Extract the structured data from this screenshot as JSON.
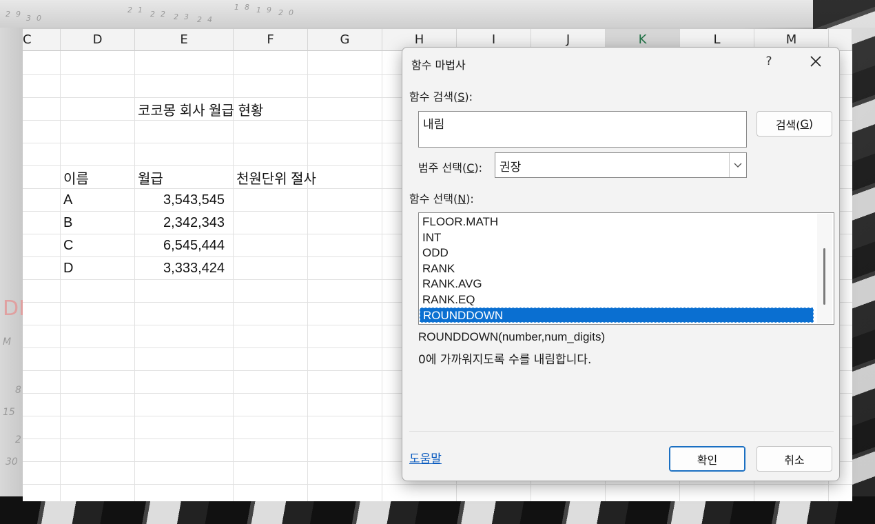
{
  "background": {
    "calendar_numbers": [
      "29",
      "30",
      "21",
      "22",
      "23",
      "24",
      "18",
      "19",
      "20"
    ],
    "left_margin_marks": [
      "DE",
      "M",
      "8",
      "15",
      "2",
      "30"
    ]
  },
  "sheet": {
    "columns": [
      "C",
      "D",
      "E",
      "F",
      "G",
      "H",
      "I",
      "J",
      "K",
      "L",
      "M"
    ],
    "selected_column": "K",
    "title": "코코몽 회사 월급 현황",
    "headers": {
      "name": "이름",
      "salary": "월급",
      "rounded": "천원단위 절사"
    },
    "rows": [
      {
        "name": "A",
        "salary": "3,543,545"
      },
      {
        "name": "B",
        "salary": "2,342,343"
      },
      {
        "name": "C",
        "salary": "6,545,444"
      },
      {
        "name": "D",
        "salary": "3,333,424"
      }
    ]
  },
  "dialog": {
    "title": "함수 마법사",
    "help_button": "?",
    "search_label": "함수 검색(",
    "search_key": "S",
    "search_label_end": "):",
    "search_value": "내림",
    "search_button": "검색(",
    "search_button_key": "G",
    "search_button_end": ")",
    "category_label": "범주 선택(",
    "category_key": "C",
    "category_label_end": "):",
    "category_value": "권장",
    "function_label": "함수 선택(",
    "function_key": "N",
    "function_label_end": "):",
    "functions": [
      "FLOOR.MATH",
      "INT",
      "ODD",
      "RANK",
      "RANK.AVG",
      "RANK.EQ",
      "ROUNDDOWN"
    ],
    "selected_function": "ROUNDDOWN",
    "syntax": "ROUNDDOWN(number,num_digits)",
    "description": "0에 가까워지도록 수를 내림합니다.",
    "help_link": "도움말",
    "ok_button": "확인",
    "cancel_button": "취소"
  }
}
